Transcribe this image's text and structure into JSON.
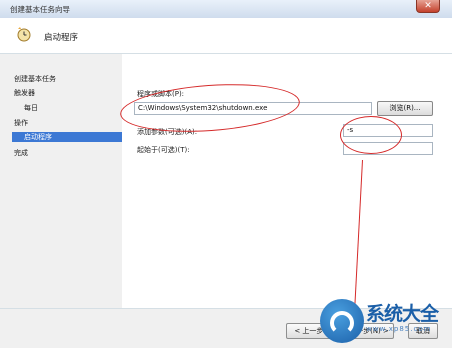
{
  "window": {
    "title": "创建基本任务向导",
    "close_glyph": "✕"
  },
  "header": {
    "title": "启动程序",
    "icon": "clock-icon"
  },
  "sidebar": {
    "items": [
      {
        "label": "创建基本任务"
      },
      {
        "label": "触发器"
      },
      {
        "label": "每日"
      },
      {
        "label": "操作"
      },
      {
        "label": "启动程序"
      },
      {
        "label": "完成"
      }
    ]
  },
  "form": {
    "program_label": "程序或脚本(P):",
    "program_value": "C:\\Windows\\System32\\shutdown.exe",
    "browse_label": "浏览(R)...",
    "args_label": "添加参数(可选)(A):",
    "args_value": "-s",
    "start_in_label": "起始于(可选)(T):",
    "start_in_value": ""
  },
  "footer": {
    "back_label": "< 上一步(B)",
    "next_label": "下一步(N) >",
    "cancel_label": "取消"
  },
  "watermark": {
    "brand": "系统大全",
    "domain": "www.xp85.com"
  },
  "colors": {
    "annotation": "#d52a2a",
    "selection": "#3c78d4"
  }
}
